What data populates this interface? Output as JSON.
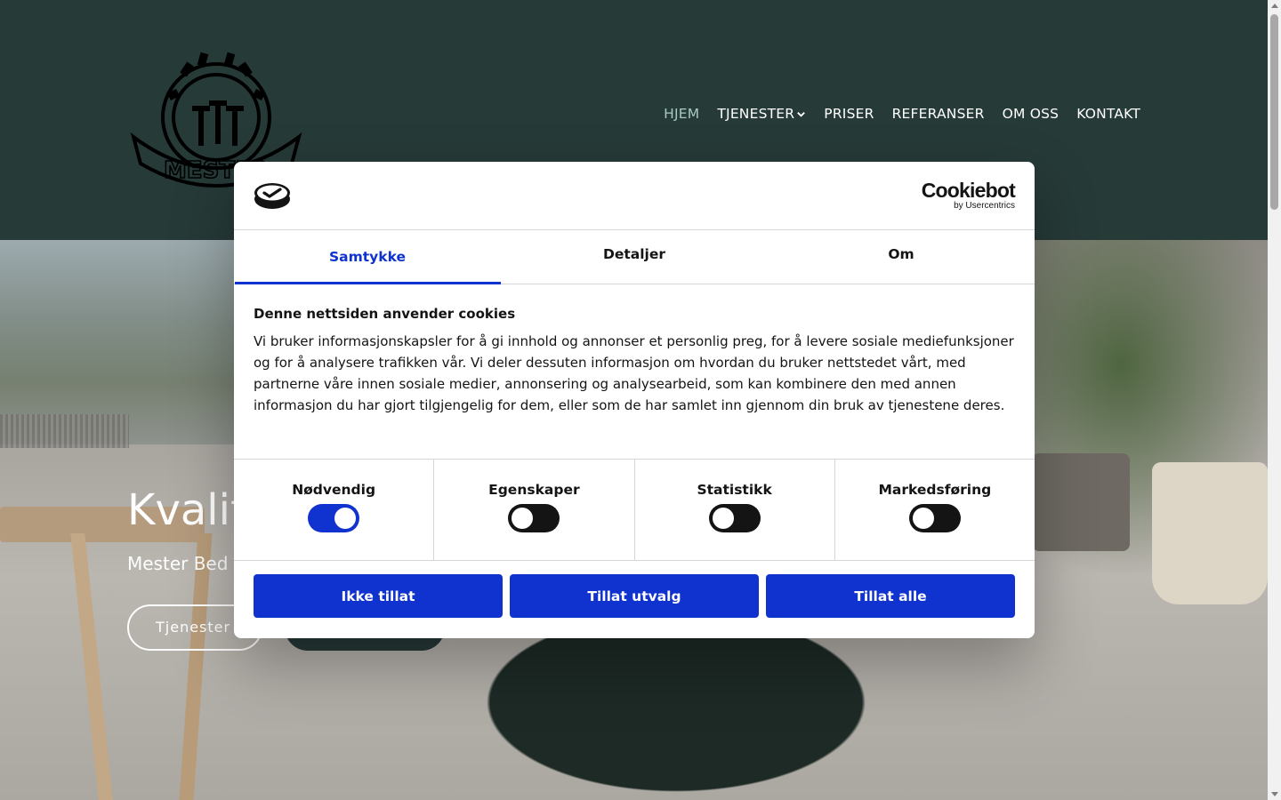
{
  "header": {
    "logo_text": "MESTER",
    "nav": [
      {
        "label": "HJEM",
        "active": true
      },
      {
        "label": "TJENESTER",
        "has_dropdown": true
      },
      {
        "label": "PRISER"
      },
      {
        "label": "REFERANSER"
      },
      {
        "label": "OM OSS"
      },
      {
        "label": "KONTAKT"
      }
    ]
  },
  "hero": {
    "title": "Kvalit",
    "subtitle": "Mester Bed",
    "button_label": "Tjenester"
  },
  "cookie_dialog": {
    "brand": {
      "name": "Cookiebot",
      "by": "by Usercentrics"
    },
    "tabs": [
      {
        "label": "Samtykke",
        "active": true
      },
      {
        "label": "Detaljer",
        "active": false
      },
      {
        "label": "Om",
        "active": false
      }
    ],
    "heading": "Denne nettsiden anvender cookies",
    "body": "Vi bruker informasjonskapsler for å gi innhold og annonser et personlig preg, for å levere sosiale mediefunksjoner og for å analysere trafikken vår. Vi deler dessuten informasjon om hvordan du bruker nettstedet vårt, med partnerne våre innen sosiale medier, annonsering og analysearbeid, som kan kombinere den med annen informasjon du har gjort tilgjengelig for dem, eller som de har samlet inn gjennom din bruk av tjenestene deres.",
    "toggles": [
      {
        "label": "Nødvendig",
        "on": true
      },
      {
        "label": "Egenskaper",
        "on": false
      },
      {
        "label": "Statistikk",
        "on": false
      },
      {
        "label": "Markedsføring",
        "on": false
      }
    ],
    "buttons": {
      "deny": "Ikke tillat",
      "allow_selection": "Tillat utvalg",
      "allow_all": "Tillat alle"
    }
  },
  "colors": {
    "header_bg": "#263a38",
    "nav_active": "#a9c9c3",
    "accent": "#1032cf"
  }
}
